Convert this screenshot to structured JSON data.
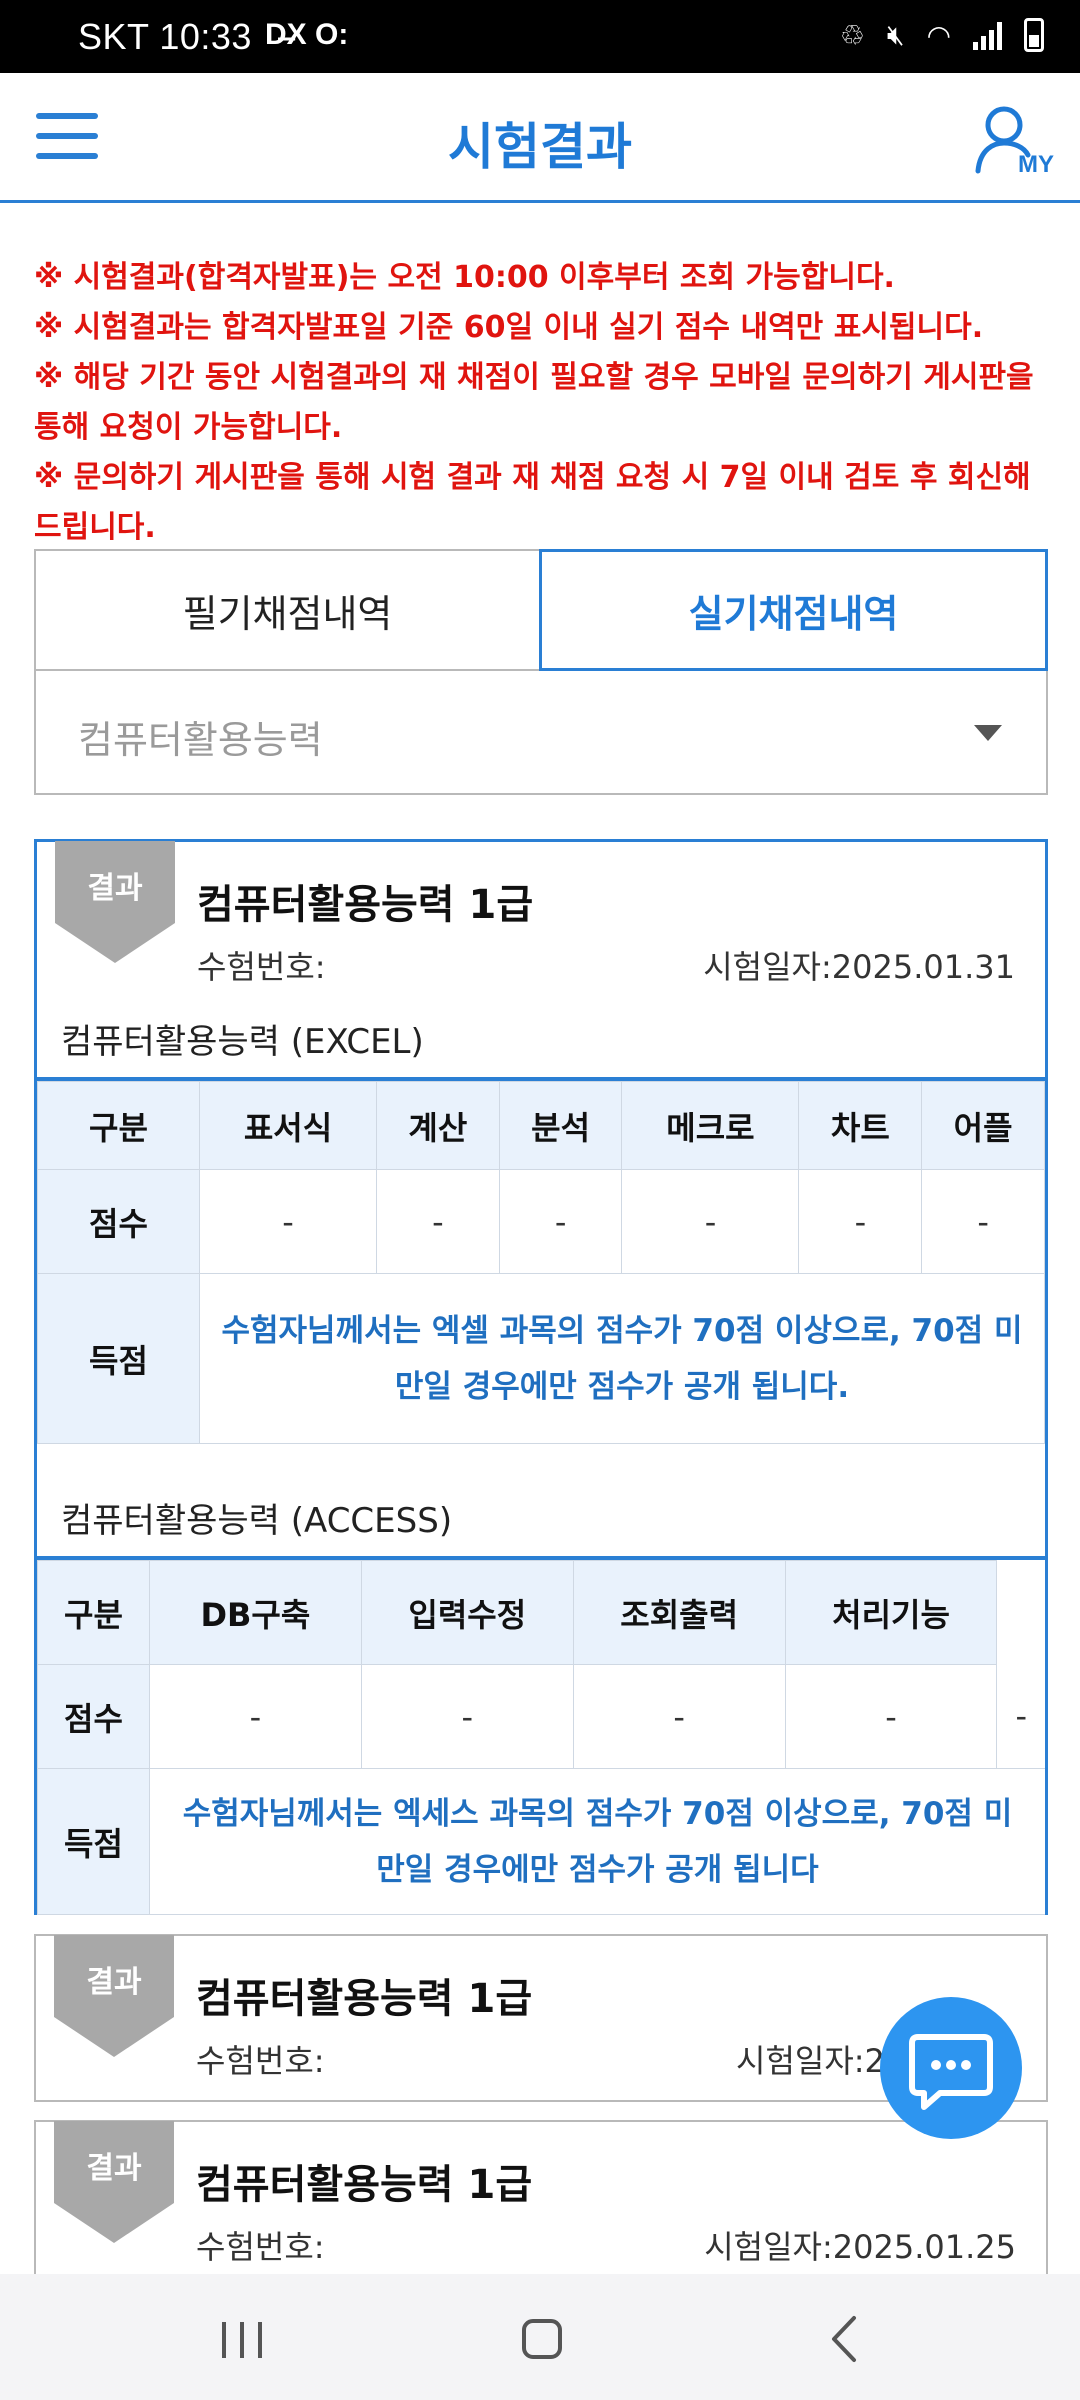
{
  "status_bar": {
    "time": "SKT 10:33",
    "left_icons": "D̶X O:",
    "icons": [
      "data-saver-icon",
      "mute-icon",
      "wifi-icon",
      "signal-icon",
      "battery-icon"
    ]
  },
  "header": {
    "title": "시험결과",
    "menu_icon": "hamburger-menu-icon",
    "my_label": "MY"
  },
  "notices": [
    "※ 시험결과(합격자발표)는 오전 10:00 이후부터 조회 가능합니다.",
    "※ 시험결과는 합격자발표일 기준 60일 이내 실기 점수 내역만 표시됩니다.",
    "※ 해당 기간 동안 시험결과의 재 채점이 필요할 경우 모바일 문의하기 게시판을 통해 요청이 가능합니다.",
    "※ 문의하기 게시판을 통해 시험 결과 재 채점 요청 시 7일 이내 검토 후 회신해 드립니다."
  ],
  "tabs": [
    {
      "label": "필기채점내역",
      "active": false
    },
    {
      "label": "실기채점내역",
      "active": true
    }
  ],
  "select": {
    "value": "컴퓨터활용능력"
  },
  "colors": {
    "accent": "#1f7ad6",
    "notice_red": "#e0140f",
    "ribbon_gray": "#a8a8a8",
    "fab_blue": "#2d95f0"
  },
  "results": [
    {
      "ribbon": "결과",
      "title": "컴퓨터활용능력 1급",
      "exam_no_label": "수험번호:",
      "exam_date": "시험일자:2025.01.31",
      "excel": {
        "section_title": "컴퓨터활용능력 (EXCEL)",
        "header_label": "구분",
        "columns": [
          "표서식",
          "계산",
          "분석",
          "메크로",
          "차트",
          "어플"
        ],
        "score_label": "점수",
        "scores": [
          "-",
          "-",
          "-",
          "-",
          "-",
          "-"
        ],
        "total_label": "득점",
        "total_note": "수험자님께서는 엑셀 과목의 점수가 70점 이상으로, 70점 미만일 경우에만 점수가 공개 됩니다."
      },
      "access": {
        "section_title": "컴퓨터활용능력 (ACCESS)",
        "header_label": "구분",
        "columns": [
          "DB구축",
          "입력수정",
          "조회출력",
          "처리기능"
        ],
        "score_label": "점수",
        "scores": [
          "-",
          "-",
          "-",
          "-",
          "-"
        ],
        "total_label": "득점",
        "total_note": "수험자님께서는 엑세스 과목의 점수가 70점 이상으로, 70점 미만일 경우에만 점수가 공개 됩니다"
      }
    },
    {
      "ribbon": "결과",
      "title": "컴퓨터활용능력 1급",
      "exam_no_label": "수험번호:",
      "exam_date": "시험일자:2"
    },
    {
      "ribbon": "결과",
      "title": "컴퓨터활용능력 1급",
      "exam_no_label": "수험번호:",
      "exam_date": "시험일자:2025.01.25"
    }
  ],
  "fab": {
    "icon": "chat-bubble-icon"
  },
  "nav": {
    "icons": [
      "recent-apps-icon",
      "home-icon",
      "back-icon"
    ]
  }
}
